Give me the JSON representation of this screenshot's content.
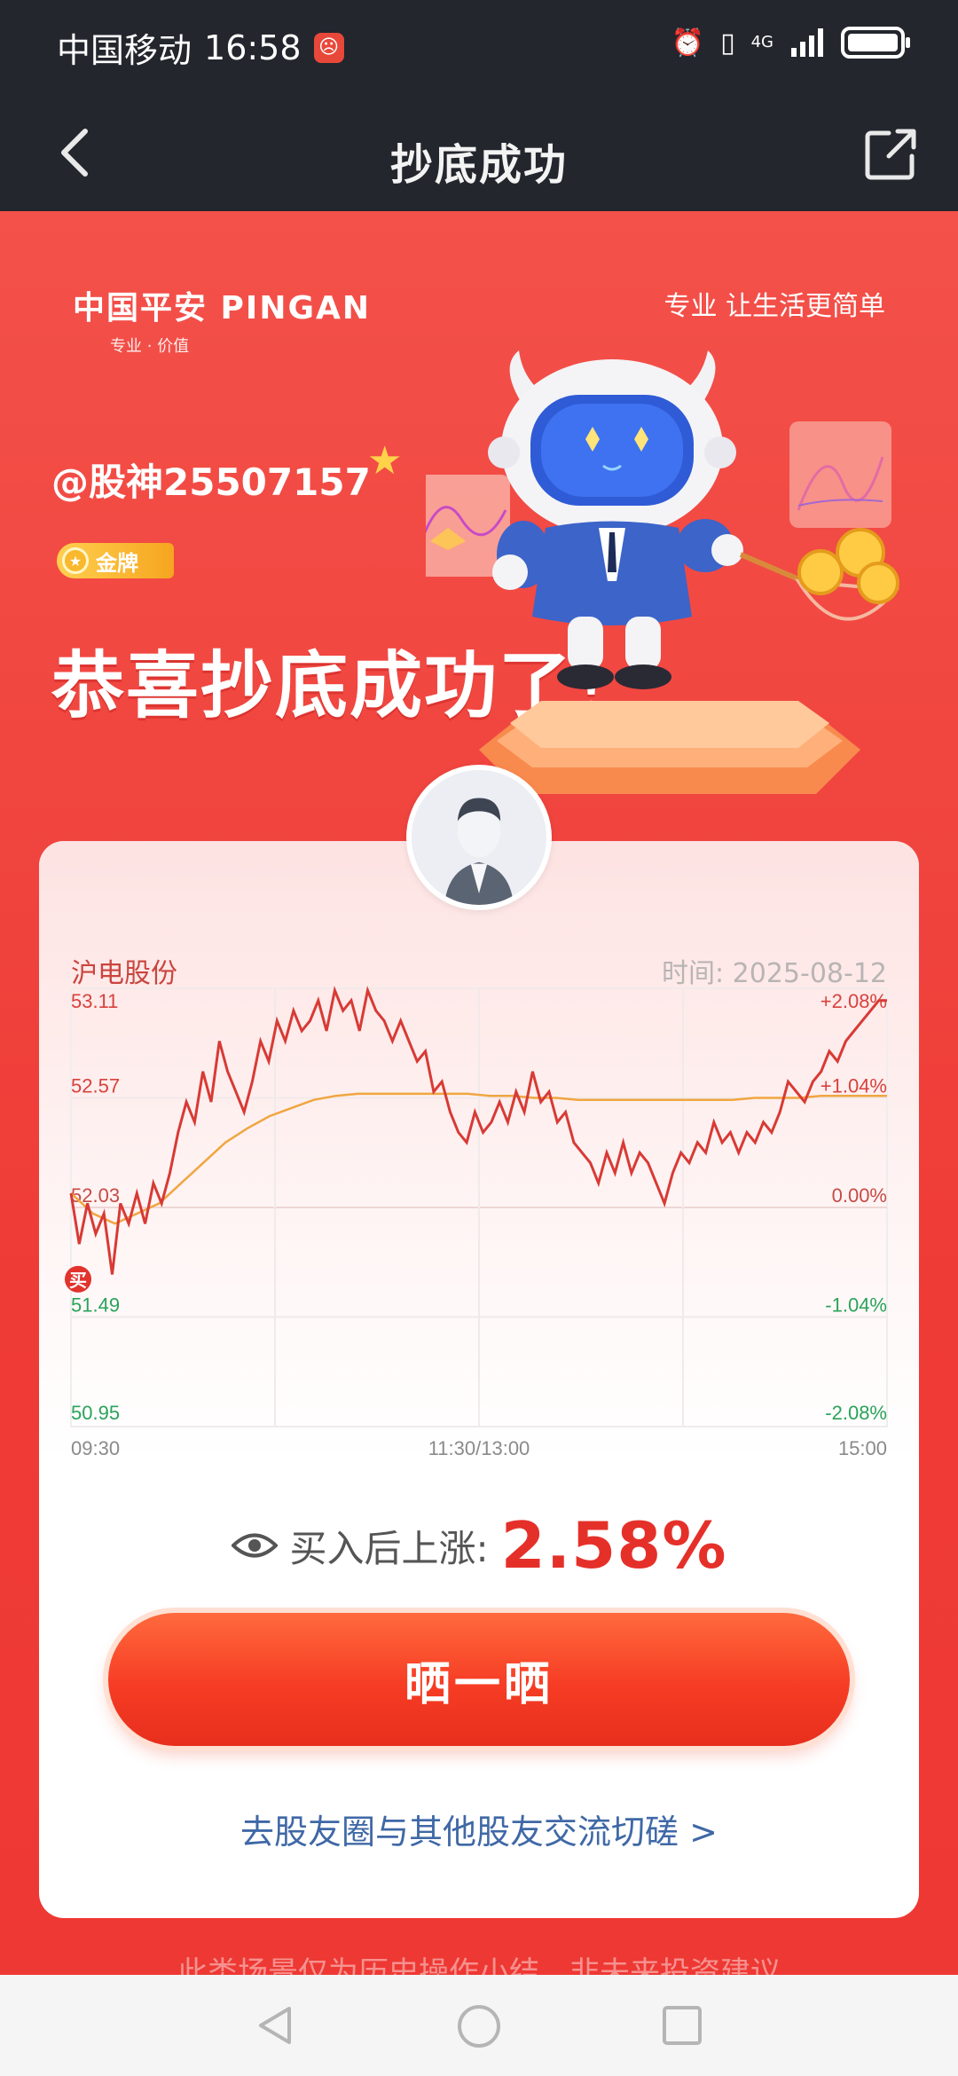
{
  "status_bar": {
    "carrier": "中国移动",
    "time": "16:58",
    "network": "4G"
  },
  "nav": {
    "title": "抄底成功",
    "back_icon": "chevron-left-icon",
    "share_icon": "share-external-icon"
  },
  "hero": {
    "logo_text": "中国平安 PINGAN",
    "logo_sub": "专业 · 价值",
    "slogan": "专业 让生活更简单",
    "username": "@股神25507157",
    "badge": "金牌",
    "congrats": "恭喜抄底成功了！"
  },
  "card": {
    "stock_name": "沪电股份",
    "time_label": "时间: 2025-08-12",
    "rise_label": "买入后上涨:",
    "rise_value": "2.58%",
    "share_button": "晒一晒",
    "community_link": "去股友圈与其他股友交流切磋 >"
  },
  "disclaimer": "此类场景仅为历史操作小结，非未来投资建议",
  "chart_data": {
    "type": "line",
    "y_price_ticks": [
      "53.11",
      "52.57",
      "52.03",
      "51.49",
      "50.95"
    ],
    "y_pct_ticks": [
      "+2.08%",
      "+1.04%",
      "0.00%",
      "-1.04%",
      "-2.08%"
    ],
    "x_ticks": [
      "09:30",
      "11:30/13:00",
      "15:00"
    ],
    "ylim": [
      50.95,
      53.11
    ],
    "buy_marker": "买",
    "colors": {
      "price": "#d83a35",
      "average": "#f0a640",
      "up": "#d8423d",
      "down": "#2aa35a"
    },
    "series": [
      {
        "values": [
          52.1,
          51.85,
          52.05,
          51.9,
          52.0,
          51.7,
          52.05,
          51.95,
          52.1,
          51.95,
          52.15,
          52.05,
          52.2,
          52.4,
          52.55,
          52.45,
          52.7,
          52.55,
          52.85,
          52.7,
          52.6,
          52.5,
          52.65,
          52.85,
          52.75,
          52.95,
          52.85,
          53.0,
          52.9,
          52.95,
          53.05,
          52.9,
          53.1,
          53.0,
          53.05,
          52.9,
          53.1,
          53.0,
          52.95,
          52.85,
          52.95,
          52.85,
          52.75,
          52.8,
          52.6,
          52.65,
          52.5,
          52.4,
          52.35,
          52.5,
          52.4,
          52.45,
          52.55,
          52.45,
          52.6,
          52.5,
          52.7,
          52.55,
          52.6,
          52.45,
          52.5,
          52.35,
          52.3,
          52.25,
          52.15,
          52.3,
          52.2,
          52.35,
          52.2,
          52.3,
          52.25,
          52.15,
          52.05,
          52.2,
          52.3,
          52.25,
          52.35,
          52.3,
          52.45,
          52.35,
          52.4,
          52.3,
          52.4,
          52.35,
          52.45,
          52.4,
          52.5,
          52.65,
          52.6,
          52.55,
          52.65,
          52.7,
          52.8,
          52.75,
          52.85,
          52.9,
          52.95,
          53.0,
          53.05,
          53.05
        ]
      },
      {
        "values": [
          52.1,
          52.0,
          51.95,
          52.0,
          52.05,
          52.15,
          52.25,
          52.35,
          52.42,
          52.48,
          52.52,
          52.56,
          52.58,
          52.59,
          52.59,
          52.59,
          52.59,
          52.59,
          52.59,
          52.58,
          52.58,
          52.57,
          52.57,
          52.56,
          52.56,
          52.56,
          52.56,
          52.56,
          52.56,
          52.56,
          52.56,
          52.57,
          52.57,
          52.57,
          52.58,
          52.58,
          52.58,
          52.58
        ]
      }
    ]
  }
}
